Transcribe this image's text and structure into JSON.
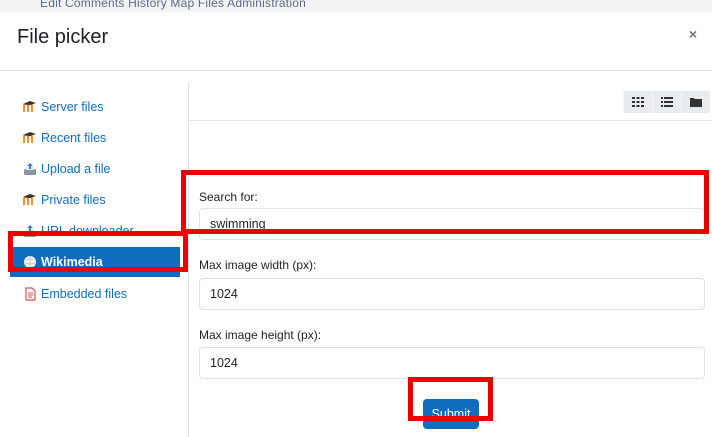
{
  "background_menu": "Edit     Comments     History     Map     Files     Administration",
  "dialog": {
    "title": "File picker",
    "close_glyph": "×"
  },
  "sidebar": {
    "items": [
      {
        "label": "Server files",
        "icon": "moodle-icon"
      },
      {
        "label": "Recent files",
        "icon": "moodle-icon"
      },
      {
        "label": "Upload a file",
        "icon": "upload-icon"
      },
      {
        "label": "Private files",
        "icon": "moodle-icon"
      },
      {
        "label": "URL downloader",
        "icon": "upload-icon"
      },
      {
        "label": "Wikimedia",
        "icon": "wikimedia-globe-icon",
        "active": true
      },
      {
        "label": "Embedded files",
        "icon": "document-icon"
      }
    ]
  },
  "toolbar": {
    "view_icons": [
      "grid-view-icon",
      "list-view-icon",
      "folder-view-icon"
    ]
  },
  "form": {
    "search_label": "Search for:",
    "search_value": "swimming",
    "width_label": "Max image width (px):",
    "width_value": "1024",
    "height_label": "Max image height (px):",
    "height_value": "1024",
    "submit_label": "Submit"
  },
  "colors": {
    "link": "#0f6cbf",
    "active_bg": "#0f6cbf",
    "highlight": "#ee0000",
    "moodle_orange": "#f98012"
  }
}
